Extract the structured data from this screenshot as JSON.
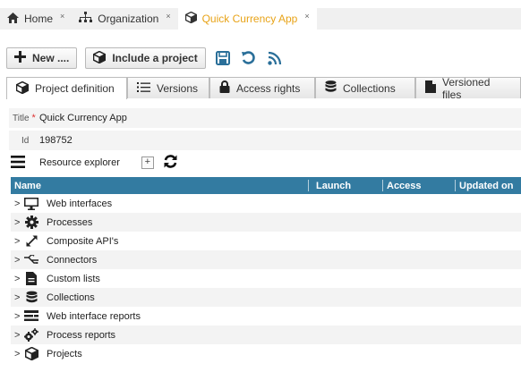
{
  "top_tabs": [
    {
      "label": "Home",
      "icon": "home-icon"
    },
    {
      "label": "Organization",
      "icon": "organization-icon"
    },
    {
      "label": "Quick Currency App",
      "icon": "cube-icon",
      "active": true
    }
  ],
  "close_glyph": "×",
  "toolbar": {
    "new_label": "New ....",
    "include_label": "Include a project",
    "icons": [
      "save-icon",
      "refresh-icon",
      "rss-icon"
    ]
  },
  "def_tabs": [
    {
      "label": "Project definition",
      "icon": "cube-icon",
      "active": true
    },
    {
      "label": "Versions",
      "icon": "list-icon"
    },
    {
      "label": "Access rights",
      "icon": "lock-icon"
    },
    {
      "label": "Collections",
      "icon": "database-icon"
    },
    {
      "label": "Versioned files",
      "icon": "file-icon"
    }
  ],
  "form": {
    "title_label": "Title",
    "required_mark": "*",
    "title_value": "Quick Currency App",
    "id_label": "Id",
    "id_value": "198752"
  },
  "resource_explorer": {
    "title": "Resource explorer",
    "add_glyph": "+"
  },
  "grid": {
    "columns": [
      "Name",
      "Launch",
      "Access",
      "Updated on"
    ],
    "rows": [
      {
        "label": "Web interfaces",
        "icon": "monitor-icon"
      },
      {
        "label": "Processes",
        "icon": "gear-icon"
      },
      {
        "label": "Composite API's",
        "icon": "expand-arrows-icon"
      },
      {
        "label": "Connectors",
        "icon": "connector-icon"
      },
      {
        "label": "Custom lists",
        "icon": "document-icon"
      },
      {
        "label": "Collections",
        "icon": "database-icon"
      },
      {
        "label": "Web interface reports",
        "icon": "report-icon"
      },
      {
        "label": "Process reports",
        "icon": "gears-icon"
      },
      {
        "label": "Projects",
        "icon": "cube-icon"
      }
    ],
    "chevron": ">"
  },
  "colors": {
    "accent_active_tab": "#e8a317",
    "grid_header": "#337ba1",
    "toolbar_icon": "#2a6f99"
  }
}
